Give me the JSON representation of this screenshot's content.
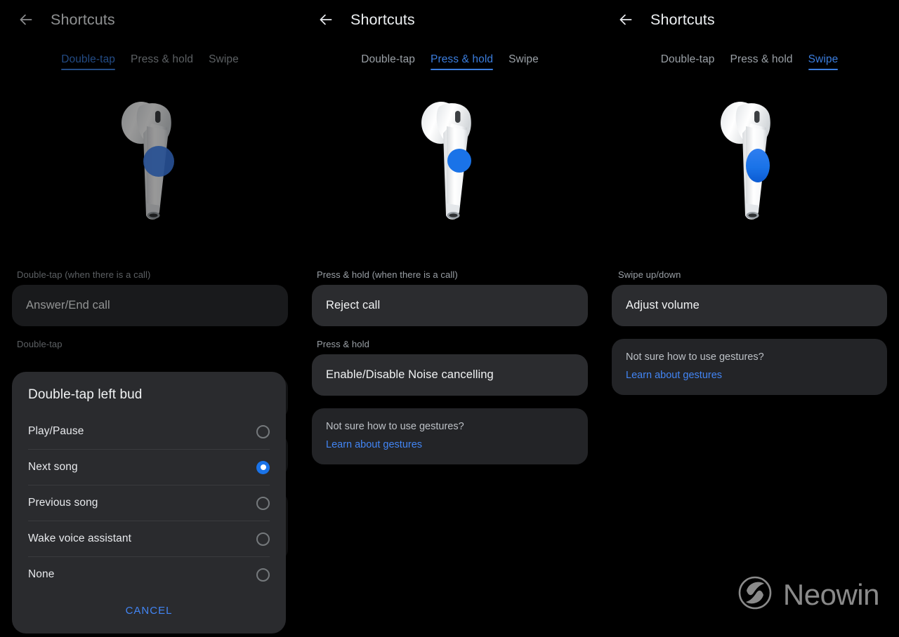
{
  "app": {
    "title": "Shortcuts",
    "back_icon": "arrow-left-icon",
    "accent_color": "#3b7ddd",
    "link_color": "#4285f4",
    "background_color": "#000000",
    "card_color": "#2b2c2f"
  },
  "tabs": [
    {
      "label": "Double-tap"
    },
    {
      "label": "Press & hold"
    },
    {
      "label": "Swipe"
    }
  ],
  "panels": [
    {
      "id": "double-tap",
      "title": "Shortcuts",
      "active_tab": "Double-tap",
      "illustration": {
        "name": "earbud-illustration",
        "highlight_shape": "circle",
        "highlight_color": "#4285f4"
      },
      "sections": [
        {
          "label": "Double-tap (when there is a call)",
          "value": "Answer/End call"
        },
        {
          "label": "Double-tap",
          "value": ""
        }
      ],
      "dialog": {
        "title": "Double-tap left bud",
        "options": [
          {
            "label": "Play/Pause",
            "selected": false
          },
          {
            "label": "Next song",
            "selected": true
          },
          {
            "label": "Previous song",
            "selected": false
          },
          {
            "label": "Wake voice assistant",
            "selected": false
          },
          {
            "label": "None",
            "selected": false
          }
        ],
        "cancel_label": "CANCEL"
      }
    },
    {
      "id": "press-hold",
      "title": "Shortcuts",
      "active_tab": "Press & hold",
      "illustration": {
        "name": "earbud-illustration",
        "highlight_shape": "circle",
        "highlight_color": "#1a73e8"
      },
      "sections": [
        {
          "label": "Press & hold (when there is a call)",
          "value": "Reject call"
        },
        {
          "label": "Press & hold",
          "value": "Enable/Disable Noise cancelling"
        }
      ],
      "info": {
        "question": "Not sure how to use gestures?",
        "link": "Learn about gestures"
      }
    },
    {
      "id": "swipe",
      "title": "Shortcuts",
      "active_tab": "Swipe",
      "illustration": {
        "name": "earbud-illustration",
        "highlight_shape": "oval",
        "highlight_color": "#1a73e8"
      },
      "sections": [
        {
          "label": "Swipe up/down",
          "value": "Adjust volume"
        }
      ],
      "info": {
        "question": "Not sure how to use gestures?",
        "link": "Learn about gestures"
      }
    }
  ],
  "watermark": {
    "text": "Neowin",
    "logo_name": "neowin-logo-icon",
    "color": "#8a8a8a"
  }
}
